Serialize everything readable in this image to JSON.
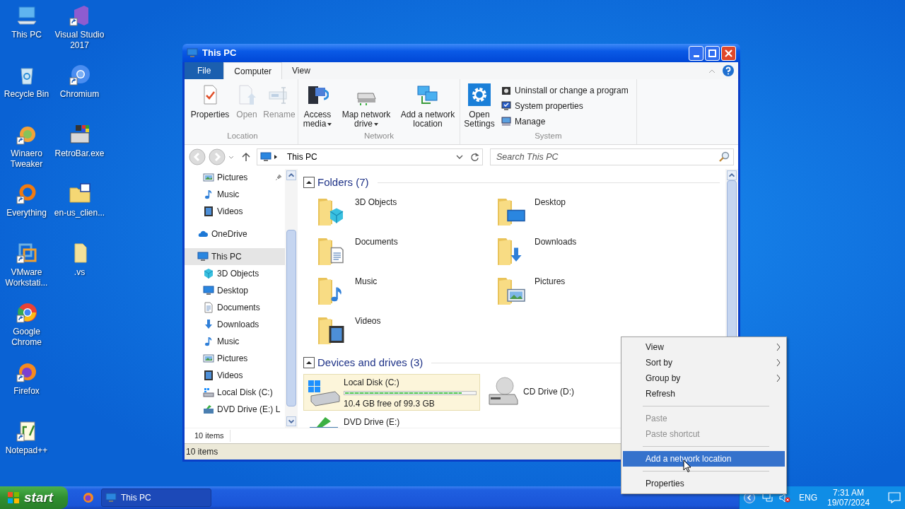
{
  "desktop_icons": [
    {
      "label": "This PC",
      "shortcut": false
    },
    {
      "label": "Recycle Bin",
      "shortcut": false
    },
    {
      "label": "Winaero Tweaker",
      "shortcut": true
    },
    {
      "label": "Everything",
      "shortcut": true
    },
    {
      "label": "VMware Workstati...",
      "shortcut": true
    },
    {
      "label": "Google Chrome",
      "shortcut": true
    },
    {
      "label": "Firefox",
      "shortcut": true
    },
    {
      "label": "Notepad++",
      "shortcut": true
    },
    {
      "label": "Visual Studio 2017",
      "shortcut": true
    },
    {
      "label": "Chromium",
      "shortcut": true
    },
    {
      "label": "RetroBar.exe",
      "shortcut": false
    },
    {
      "label": "en-us_clien...",
      "shortcut": false
    },
    {
      "label": ".vs",
      "shortcut": false
    }
  ],
  "window": {
    "title": "This PC",
    "ribbon_tabs": [
      {
        "label": "File",
        "kind": "file",
        "selected": false
      },
      {
        "label": "Computer",
        "kind": "tab",
        "selected": true
      },
      {
        "label": "View",
        "kind": "tab",
        "selected": false
      }
    ],
    "ribbon_groups": [
      {
        "label": "Location",
        "commands": [
          {
            "label": "Properties",
            "disabled": false,
            "dropdown": false
          },
          {
            "label": "Open",
            "disabled": true,
            "dropdown": false
          },
          {
            "label": "Rename",
            "disabled": true,
            "dropdown": false
          }
        ]
      },
      {
        "label": "Network",
        "commands": [
          {
            "label": "Access media",
            "disabled": false,
            "dropdown": true
          },
          {
            "label": "Map network drive",
            "disabled": false,
            "dropdown": true
          },
          {
            "label": "Add a network location",
            "disabled": false,
            "dropdown": false
          }
        ]
      },
      {
        "label": "System",
        "commands": [
          {
            "label": "Open Settings",
            "disabled": false,
            "dropdown": false
          }
        ],
        "small_commands": [
          {
            "label": "Uninstall or change a program"
          },
          {
            "label": "System properties"
          },
          {
            "label": "Manage"
          }
        ]
      }
    ],
    "address": {
      "path": "This PC",
      "search_placeholder": "Search This PC"
    },
    "nav": {
      "quick_access_items": [
        {
          "label": "Pictures",
          "pinned": true,
          "selected": false
        },
        {
          "label": "Music",
          "pinned": false,
          "selected": false
        },
        {
          "label": "Videos",
          "pinned": false,
          "selected": false
        }
      ],
      "items": [
        {
          "label": "OneDrive",
          "selected": false
        },
        {
          "label": "This PC",
          "selected": true,
          "children": [
            {
              "label": "3D Objects",
              "selected": false
            },
            {
              "label": "Desktop",
              "selected": false
            },
            {
              "label": "Documents",
              "selected": false
            },
            {
              "label": "Downloads",
              "selected": false
            },
            {
              "label": "Music",
              "selected": false
            },
            {
              "label": "Pictures",
              "selected": false
            },
            {
              "label": "Videos",
              "selected": false
            },
            {
              "label": "Local Disk (C:)",
              "selected": false
            },
            {
              "label": "DVD Drive (E:) L",
              "selected": false
            }
          ]
        }
      ]
    },
    "sections": [
      {
        "title": "Folders (7)",
        "expanded": true,
        "items": [
          {
            "label": "3D Objects"
          },
          {
            "label": "Desktop"
          },
          {
            "label": "Documents"
          },
          {
            "label": "Downloads"
          },
          {
            "label": "Music"
          },
          {
            "label": "Pictures"
          },
          {
            "label": "Videos"
          }
        ]
      },
      {
        "title": "Devices and drives (3)",
        "expanded": true,
        "items": [
          {
            "label": "Local Disk (C:)",
            "kind": "disk",
            "selected": true,
            "level": 0.895,
            "free": "10.4 GB free of 99.3 GB"
          },
          {
            "label": "CD Drive (D:)",
            "kind": "cd",
            "selected": false
          },
          {
            "label": "DVD Drive (E:)",
            "kind": "dvd",
            "selected": false
          }
        ]
      }
    ],
    "footer": "10 items",
    "status_bar": "10 items"
  },
  "context_menu": [
    {
      "kind": "item",
      "label": "View",
      "submenu": true,
      "disabled": false,
      "selected": false
    },
    {
      "kind": "item",
      "label": "Sort by",
      "submenu": true,
      "disabled": false,
      "selected": false
    },
    {
      "kind": "item",
      "label": "Group by",
      "submenu": true,
      "disabled": false,
      "selected": false
    },
    {
      "kind": "item",
      "label": "Refresh",
      "submenu": false,
      "disabled": false,
      "selected": false
    },
    {
      "kind": "separator"
    },
    {
      "kind": "item",
      "label": "Paste",
      "submenu": false,
      "disabled": true,
      "selected": false
    },
    {
      "kind": "item",
      "label": "Paste shortcut",
      "submenu": false,
      "disabled": true,
      "selected": false
    },
    {
      "kind": "separator"
    },
    {
      "kind": "item",
      "label": "Add a network location",
      "submenu": false,
      "disabled": false,
      "selected": true
    },
    {
      "kind": "separator"
    },
    {
      "kind": "item",
      "label": "Properties",
      "submenu": false,
      "disabled": false,
      "selected": false
    }
  ],
  "taskbar": {
    "start": "start",
    "tasks": [
      {
        "label": "This PC",
        "selected": true
      }
    ],
    "language": "ENG",
    "time": "7:31 AM",
    "date": "19/07/2024"
  }
}
